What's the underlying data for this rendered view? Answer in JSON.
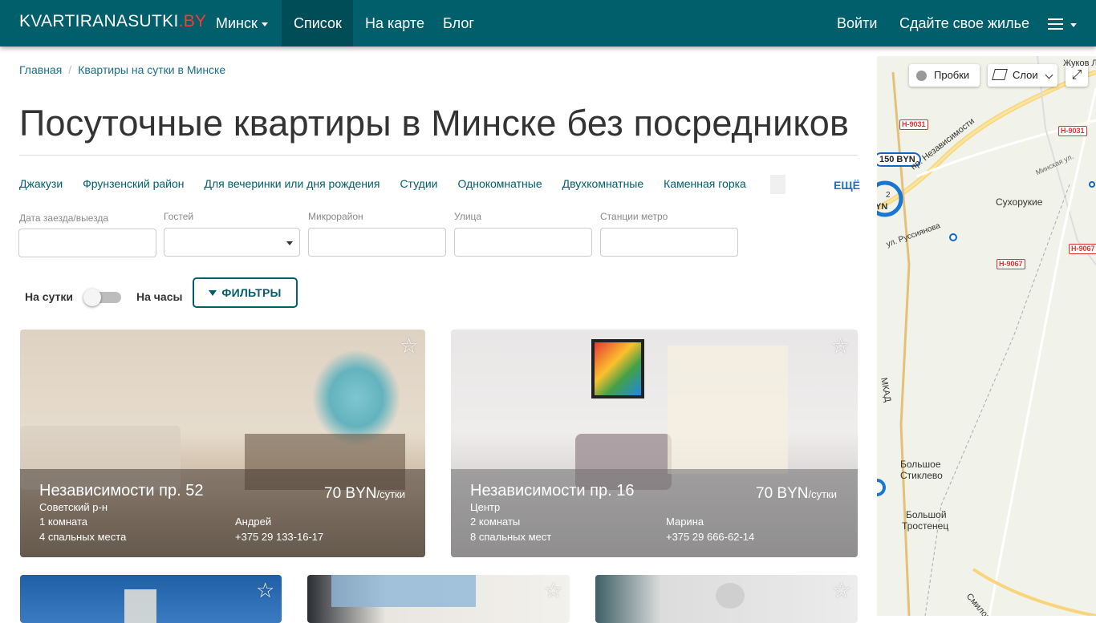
{
  "nav": {
    "brand": "KVARTIRANASUTKI",
    "brand_tld": ".BY",
    "city": "Минск",
    "list": "Список",
    "map": "На карте",
    "blog": "Блог",
    "login": "Войти",
    "rent_out": "Сдайте свое жилье"
  },
  "breadcrumb": {
    "home": "Главная",
    "sep": "/",
    "current": "Квартиры на сутки в Минске"
  },
  "title": "Посуточные квартиры в Минске без посредников",
  "tags": [
    "Джакузи",
    "Фрунзенский район",
    "Для вечеринки или дня рождения",
    "Студии",
    "Однокомнатные",
    "Двухкомнатные",
    "Каменная горка"
  ],
  "more": "ЕЩЁ",
  "filters": {
    "dates_label": "Дата заезда/выезда",
    "guests_label": "Гостей",
    "district_label": "Микрорайон",
    "street_label": "Улица",
    "metro_label": "Станции метро",
    "per_day": "На сутки",
    "per_hour": "На часы",
    "filters_button": "ФИЛЬТРЫ"
  },
  "listings": [
    {
      "title": "Независимости пр. 52",
      "district": "Советский р-н",
      "rooms": "1 комната",
      "beds": "4 спальных места",
      "owner": "Андрей",
      "phone": "+375 29 133-16-17",
      "price": "70 BYN",
      "unit": "/сутки"
    },
    {
      "title": "Независимости пр. 16",
      "district": "Центр",
      "rooms": "2 комнаты",
      "beds": "8 спальных мест",
      "owner": "Марина",
      "phone": "+375 29 666-62-14",
      "price": "70 BYN",
      "unit": "/сутки"
    }
  ],
  "map": {
    "traffic": "Пробки",
    "layers": "Слои",
    "labels": {
      "zhukov": "Жуков Луг",
      "sukhorukie": "Сухорукие",
      "bolshoe": "Большое",
      "stiklevo": "Стиклево",
      "bolshoy": "Большой",
      "trostenets": "Тростенец",
      "mkad": "МКАД",
      "minskaya": "Минская ул.",
      "nezav": "пр. Независимости",
      "rusiyanova": "ул. Руссиянова",
      "smilov": "Смилови"
    },
    "roads": [
      "Н-9031",
      "Н-9031",
      "Н-9067",
      "Н-9067"
    ],
    "pin_price": "150 BYN",
    "pin_partial": "YN",
    "pin_count": "2"
  },
  "colors": {
    "navbar": "#005f6b",
    "accent": "#005f6b",
    "link": "#1a6f8a",
    "brand_tld": "#ff3b30"
  }
}
